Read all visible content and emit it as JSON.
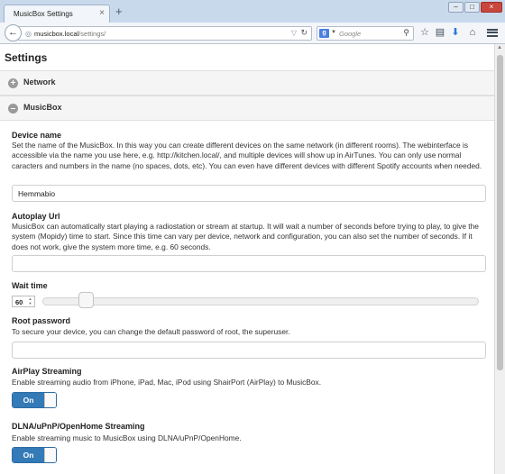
{
  "browser": {
    "tab_title": "MusicBox Settings",
    "tab_close": "×",
    "new_tab": "+",
    "window_minimize": "–",
    "window_maximize": "□",
    "window_close": "×",
    "url_host": "musicbox.local",
    "url_path": "/settings/",
    "search_placeholder": "Google",
    "search_engine_letter": "g"
  },
  "page": {
    "title": "Settings",
    "panels": {
      "network": {
        "label": "Network",
        "icon": "+"
      },
      "musicbox": {
        "label": "MusicBox",
        "icon": "–"
      }
    },
    "device_name": {
      "label": "Device name",
      "description": "Set the name of the MusicBox. In this way you can create different devices on the same network (in different rooms). The webinterface is accessible via the name you use here, e.g. http://kitchen.local/, and multiple devices will show up in AirTunes. You can only use normal caracters and numbers in the name (no spaces, dots, etc). You can even have different devices with different Spotify accounts when needed.",
      "value": "Hemmabio"
    },
    "autoplay_url": {
      "label": "Autoplay Url",
      "description": "MusicBox can automatically start playing a radiostation or stream at startup. It will wait a number of seconds before trying to play, to give the system (Mopidy) time to start. Since this time can vary per device, network and configuration, you can also set the number of seconds. If it does not work, give the system more time, e.g. 60 seconds.",
      "value": ""
    },
    "wait_time": {
      "label": "Wait time",
      "value": "60",
      "slider_fraction": 0.1
    },
    "root_password": {
      "label": "Root password",
      "description": "To secure your device, you can change the default password of root, the superuser.",
      "value": ""
    },
    "airplay": {
      "label": "AirPlay Streaming",
      "description": "Enable streaming audio from iPhone, iPad, Mac, iPod using ShairPort (AirPlay) to MusicBox.",
      "toggle": "On"
    },
    "dlna": {
      "label": "DLNA/uPnP/OpenHome Streaming",
      "description": "Enable streaming music to MusicBox using DLNA/uPnP/OpenHome.",
      "toggle": "On"
    }
  },
  "colors": {
    "toggle_on": "#337ab7",
    "chrome": "#c9d9ec"
  }
}
